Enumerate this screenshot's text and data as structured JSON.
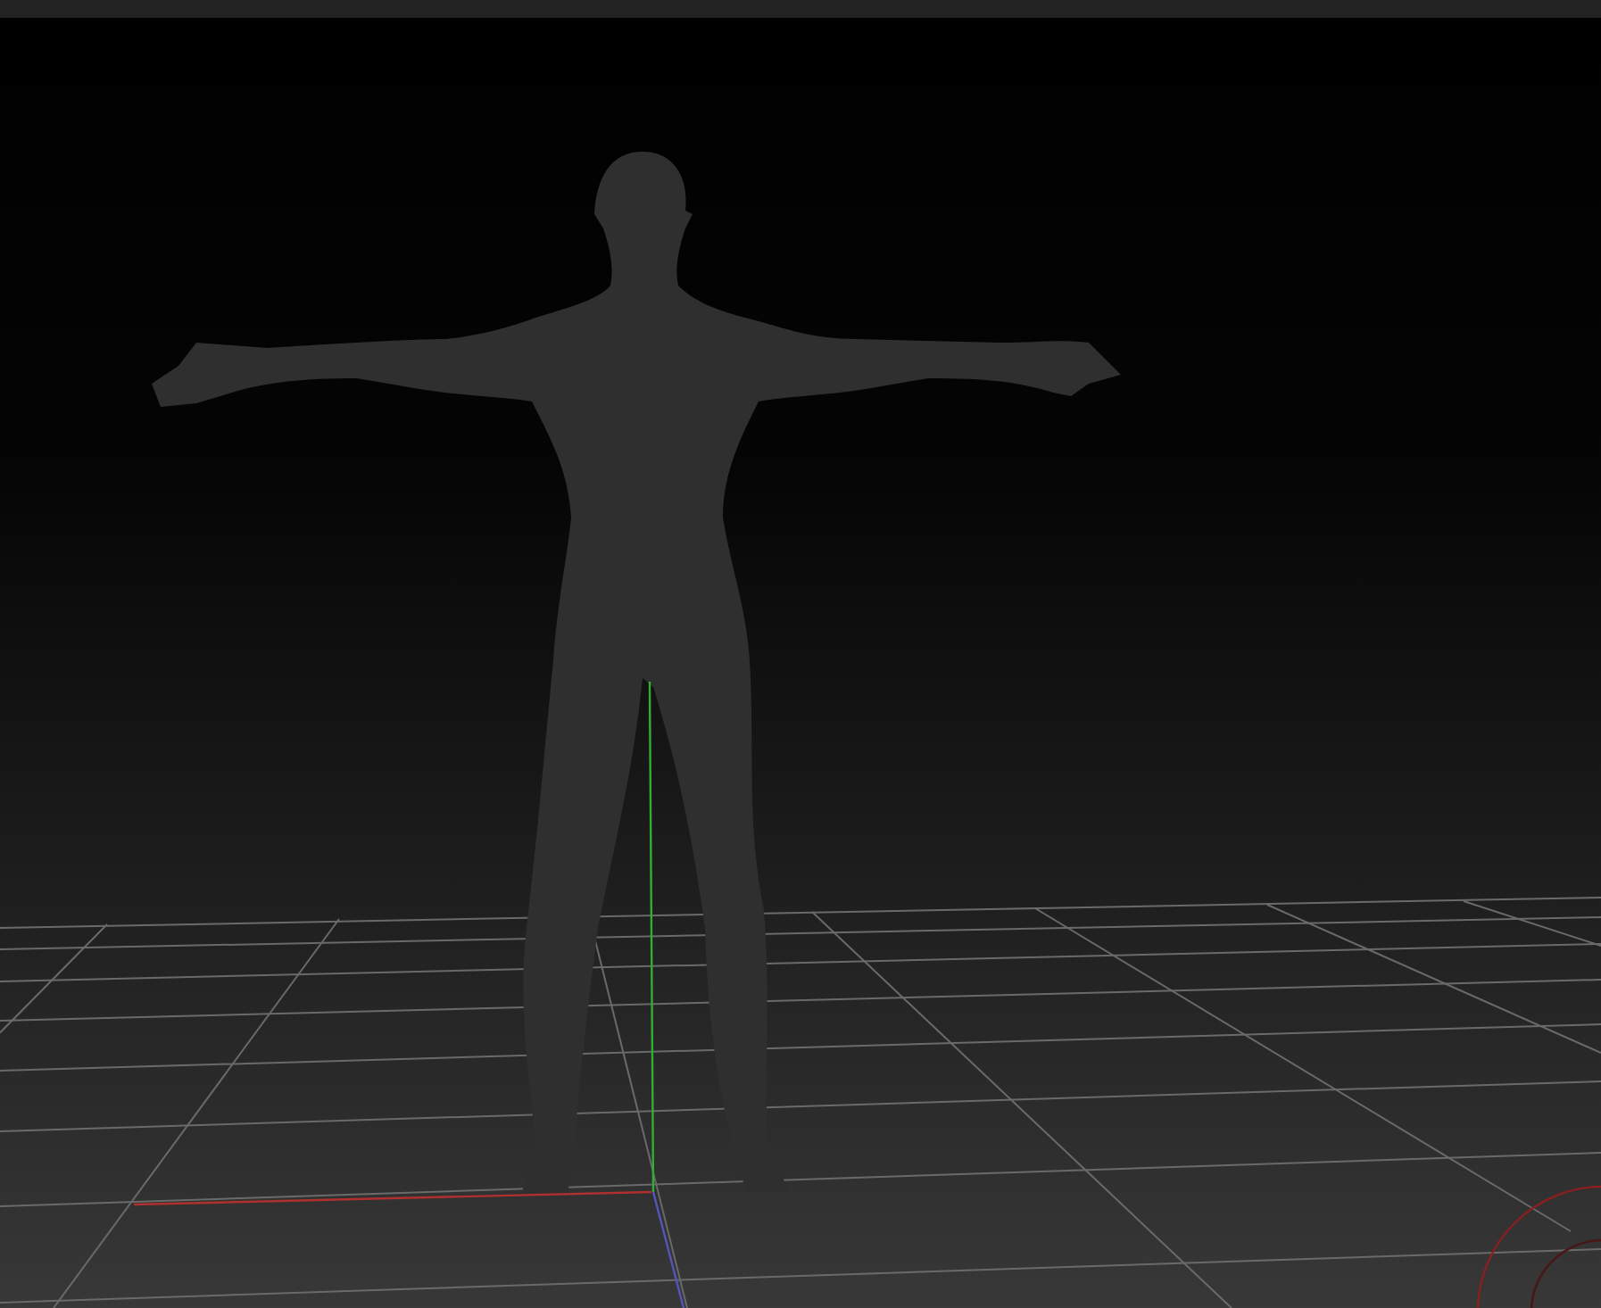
{
  "viewport": {
    "grid": true,
    "axes": true,
    "gizmo": true
  }
}
